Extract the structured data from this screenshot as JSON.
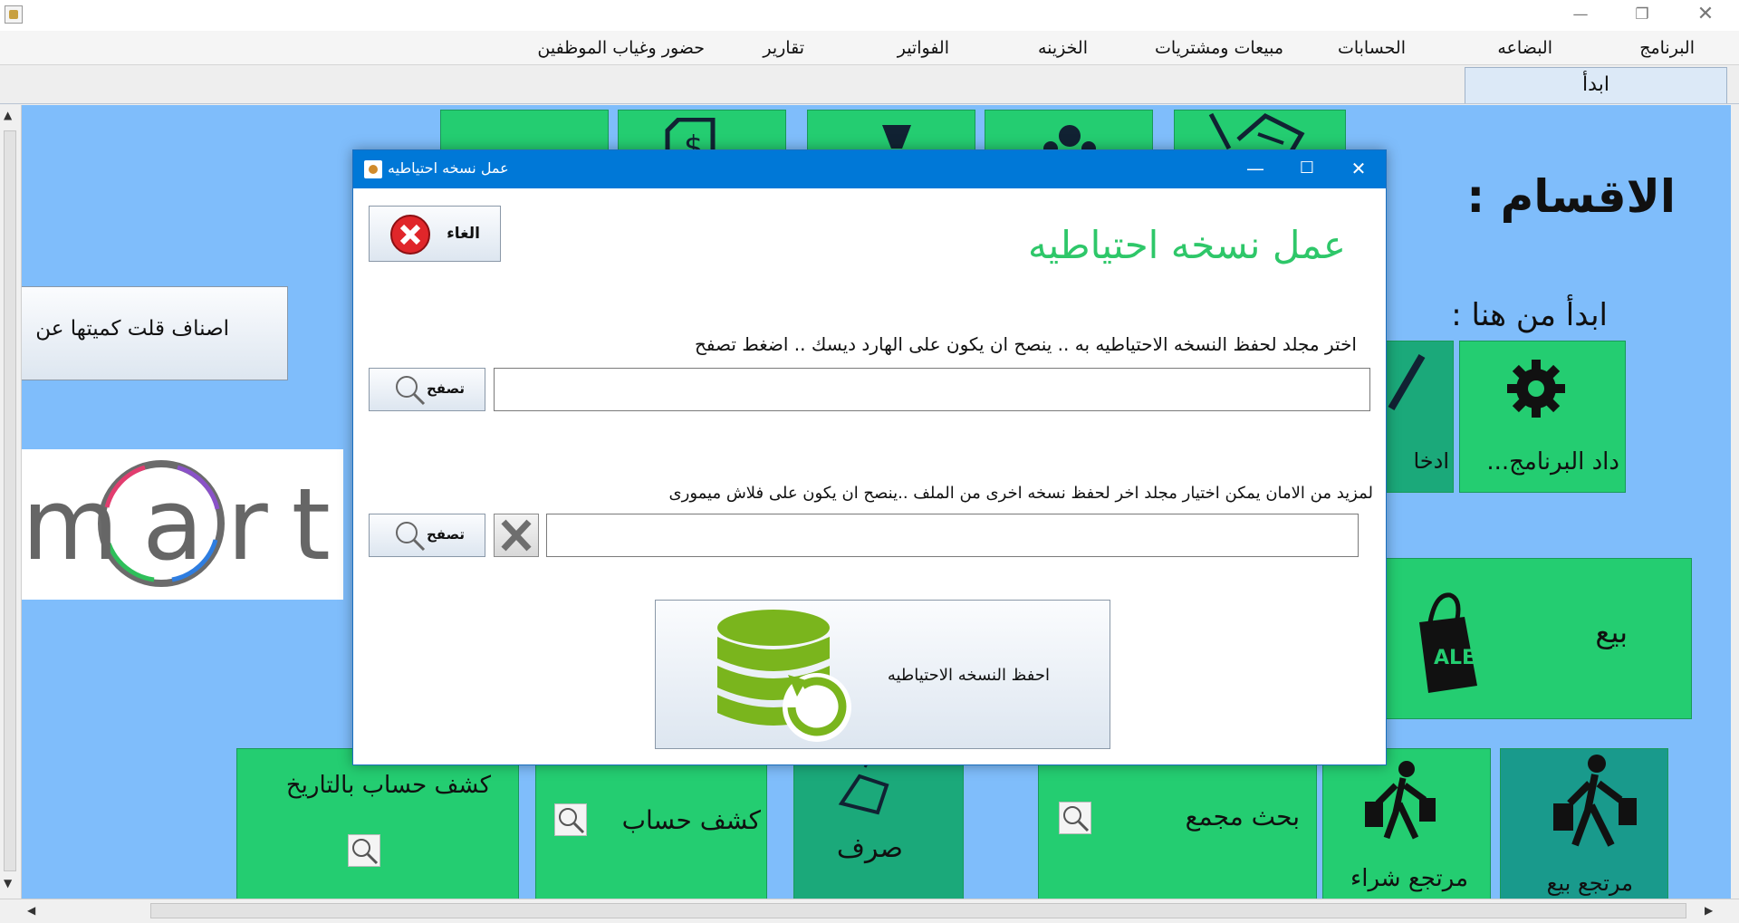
{
  "menu": {
    "items": [
      "البرنامج",
      "البضاعه",
      "الحسابات",
      "مبيعات ومشتريات",
      "الخزينه",
      "الفواتير",
      "تقارير",
      "حضور وغياب الموظفين"
    ]
  },
  "tabs": {
    "active": "ابدأ"
  },
  "main": {
    "sections_title": "الاقسام :",
    "start_here": "ابدأ من هنا :",
    "low_stock_button": "اصناف قلت كميتها عن",
    "settings_tile": "داد البرنامج...",
    "entry_tile": "ادخا",
    "sell_tile": "بيع",
    "account_by_date_tile": "كشف حساب بالتاريخ",
    "account_tile": "كشف حساب",
    "expense_tile": "صرف",
    "combined_search_tile": "بحث مجمع",
    "purchase_return_tile": "مرتجع شراء",
    "sale_return_tile": "مرتجع بيع",
    "sale_badge": "ALE",
    "logo_text": "mart"
  },
  "dialog": {
    "title": "عمل نسخه احتياطيه",
    "heading": "عمل نسخه احتياطيه",
    "cancel_label": "الغاء",
    "instruction_primary": "اختر مجلد لحفظ النسخه الاحتياطيه به .. ينصح ان يكون على الهارد ديسك .. اضغط تصفح",
    "browse_label": "تصفح",
    "primary_path": "",
    "instruction_secondary": "لمزيد من الامان يمكن اختيار مجلد اخر لحفظ نسخه اخرى من الملف ..ينصح ان يكون على فلاش ميمورى",
    "secondary_path": "",
    "save_backup_label": "احفظ النسخه الاحتياطيه"
  },
  "colors": {
    "panel_blue": "#7fbdfb",
    "tile_green": "#24cd71",
    "dialog_title_blue": "#0078d7",
    "heading_green": "#2ec769",
    "db_icon_green": "#7ab51d",
    "cancel_red": "#e0262a"
  }
}
